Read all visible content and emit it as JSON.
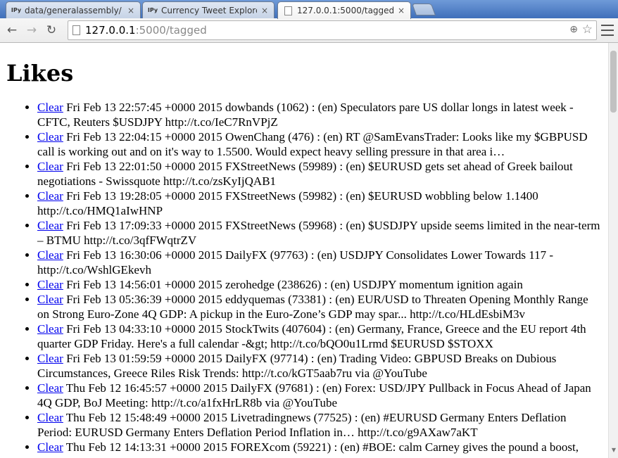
{
  "browser": {
    "tabs": [
      {
        "icon": "IPy",
        "title": "data/generalassembly/",
        "active": false
      },
      {
        "icon": "IPy",
        "title": "Currency Tweet Explorer",
        "active": false
      },
      {
        "icon": "page",
        "title": "127.0.0.1:5000/tagged",
        "active": true
      }
    ],
    "close_glyph": "×",
    "url_host": "127.0.0.1",
    "url_rest": ":5000/tagged"
  },
  "page": {
    "heading": "Likes",
    "clear_label": "Clear",
    "items": [
      {
        "text": " Fri Feb 13 22:57:45 +0000 2015 dowbands (1062) : (en) Speculators pare US dollar longs in latest week - CFTC, Reuters $USDJPY http://t.co/IeC7RnVPjZ"
      },
      {
        "text": " Fri Feb 13 22:04:15 +0000 2015 OwenChang (476) : (en) RT @SamEvansTrader: Looks like my $GBPUSD call is working out and on it's way to 1.5500. Would expect heavy selling pressure in that area i…"
      },
      {
        "text": " Fri Feb 13 22:01:50 +0000 2015 FXStreetNews (59989) : (en) $EURUSD gets set ahead of Greek bailout negotiations - Swissquote http://t.co/zsKyIjQAB1"
      },
      {
        "text": " Fri Feb 13 19:28:05 +0000 2015 FXStreetNews (59982) : (en) $EURUSD wobbling below 1.1400 http://t.co/HMQ1aIwHNP"
      },
      {
        "text": " Fri Feb 13 17:09:33 +0000 2015 FXStreetNews (59968) : (en) $USDJPY upside seems limited in the near-term – BTMU http://t.co/3qfFWqtrZV"
      },
      {
        "text": " Fri Feb 13 16:30:06 +0000 2015 DailyFX (97763) : (en) USDJPY Consolidates Lower Towards 117 - http://t.co/WshlGEkevh"
      },
      {
        "text": " Fri Feb 13 14:56:01 +0000 2015 zerohedge (238626) : (en) USDJPY momentum ignition again"
      },
      {
        "text": " Fri Feb 13 05:36:39 +0000 2015 eddyquemas (73381) : (en) EUR/USD to Threaten Opening Monthly Range on Strong Euro-Zone 4Q GDP: A pickup in the Euro-Zone’s GDP may spar... http://t.co/HLdEsbiM3v"
      },
      {
        "text": " Fri Feb 13 04:33:10 +0000 2015 StockTwits (407604) : (en) Germany, France, Greece and the EU report 4th quarter GDP Friday. Here's a full calendar -&gt; http://t.co/bQO0u1Lrmd $EURUSD $STOXX"
      },
      {
        "text": " Fri Feb 13 01:59:59 +0000 2015 DailyFX (97714) : (en) Trading Video: GBPUSD Breaks on Dubious Circumstances, Greece Riles Risk Trends: http://t.co/kGT5aab7ru via @YouTube"
      },
      {
        "text": " Thu Feb 12 16:45:57 +0000 2015 DailyFX (97681) : (en) Forex: USD/JPY Pullback in Focus Ahead of Japan 4Q GDP, BoJ Meeting: http://t.co/a1fxHrLR8b via @YouTube"
      },
      {
        "text": " Thu Feb 12 15:48:49 +0000 2015 Livetradingnews (77525) : (en) #EURUSD Germany Enters Deflation Period: EURUSD Germany Enters Deflation Period Inflation in… http://t.co/g9AXaw7aKT"
      },
      {
        "text": " Thu Feb 12 14:13:31 +0000 2015 FOREXcom (59221) : (en) #BOE: calm Carney gives the pound a boost,"
      }
    ]
  }
}
